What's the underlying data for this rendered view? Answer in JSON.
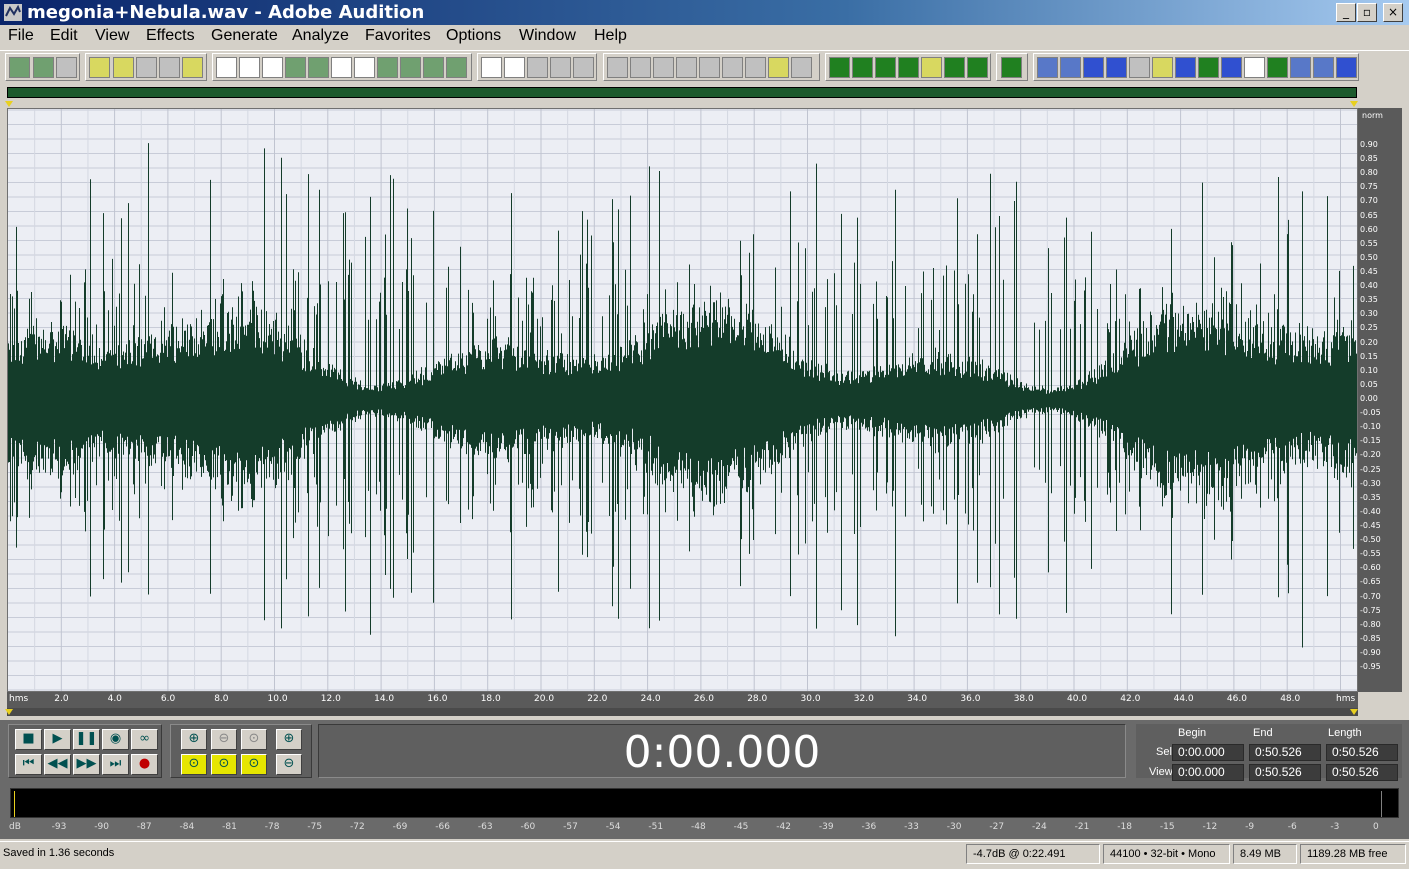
{
  "window": {
    "title": "megonia+Nebula.wav - Adobe Audition",
    "controls": [
      "_",
      "▫",
      "×"
    ]
  },
  "menu": [
    "File",
    "Edit",
    "View",
    "Effects",
    "Generate",
    "Analyze",
    "Favorites",
    "Options",
    "Window",
    "Help"
  ],
  "amplitude_scale": {
    "header": "norm",
    "ticks": [
      "0.90",
      "0.85",
      "0.80",
      "0.75",
      "0.70",
      "0.65",
      "0.60",
      "0.55",
      "0.50",
      "0.45",
      "0.40",
      "0.35",
      "0.30",
      "0.25",
      "0.20",
      "0.15",
      "0.10",
      "0.05",
      "0.00",
      "-0.05",
      "-0.10",
      "-0.15",
      "-0.20",
      "-0.25",
      "-0.30",
      "-0.35",
      "-0.40",
      "-0.45",
      "-0.50",
      "-0.55",
      "-0.60",
      "-0.65",
      "-0.70",
      "-0.75",
      "-0.80",
      "-0.85",
      "-0.90",
      "-0.95"
    ]
  },
  "time_ruler": {
    "unit": "hms",
    "ticks": [
      "2.0",
      "4.0",
      "6.0",
      "8.0",
      "10.0",
      "12.0",
      "14.0",
      "16.0",
      "18.0",
      "20.0",
      "22.0",
      "24.0",
      "26.0",
      "28.0",
      "30.0",
      "32.0",
      "34.0",
      "36.0",
      "38.0",
      "40.0",
      "42.0",
      "44.0",
      "46.0",
      "48.0"
    ],
    "unit_right": "hms"
  },
  "transport": {
    "current_time": "0:00.000"
  },
  "selection": {
    "headers": [
      "Begin",
      "End",
      "Length"
    ],
    "rows": [
      {
        "label": "Sel",
        "begin": "0:00.000",
        "end": "0:50.526",
        "length": "0:50.526"
      },
      {
        "label": "View",
        "begin": "0:00.000",
        "end": "0:50.526",
        "length": "0:50.526"
      }
    ]
  },
  "level_meter": {
    "ticks": [
      "dB",
      "-93",
      "-90",
      "-87",
      "-84",
      "-81",
      "-78",
      "-75",
      "-72",
      "-69",
      "-66",
      "-63",
      "-60",
      "-57",
      "-54",
      "-51",
      "-48",
      "-45",
      "-42",
      "-39",
      "-36",
      "-33",
      "-30",
      "-27",
      "-24",
      "-21",
      "-18",
      "-15",
      "-12",
      "-9",
      "-6",
      "-3",
      "0"
    ]
  },
  "status": {
    "message": "Saved in 1.36 seconds",
    "level_at_cursor": "-4.7dB @  0:22.491",
    "format": "44100 • 32-bit • Mono",
    "file_size": "8.49 MB",
    "free_space": "1189.28 MB free"
  },
  "colors": {
    "waveform": "#143c2a",
    "waveform_bg": "#eceef4",
    "overview": "#1c5a2c",
    "marker": "#e8d020"
  }
}
